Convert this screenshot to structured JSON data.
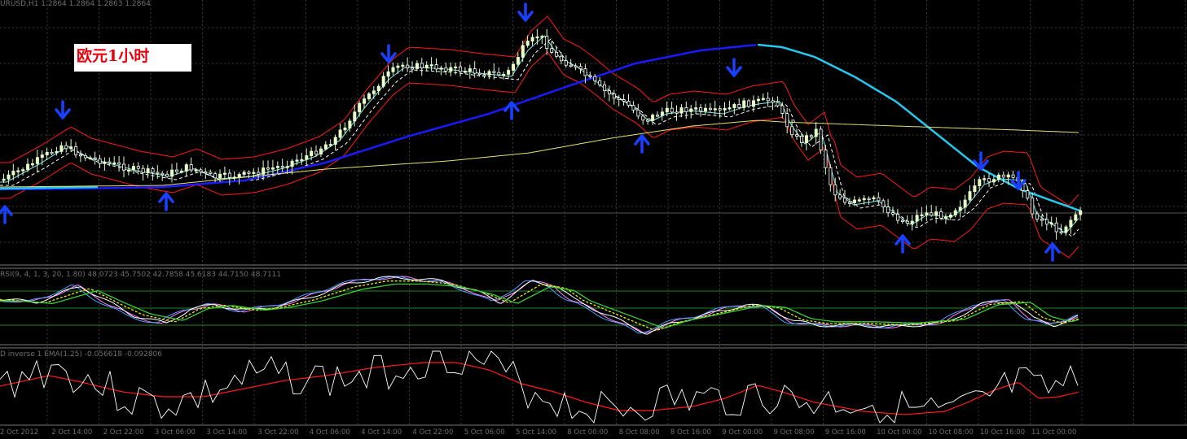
{
  "main_header": "URUSD,H1  1.2864 1.2864 1.2863 1.2864",
  "caption": "欧元1小时",
  "rsi_header": "RSI(9, 4, 1, 3, 20, 1.80) 48.0723 45.7502 42.7858 45.6183 44.7150 48.7111",
  "ind2_header": "D inverse 1  EMA(1.25) -0.056618 -0.092806",
  "time_axis": [
    "2 Oct 2012",
    "2 Oct 14:00",
    "2 Oct 22:00",
    "3 Oct 06:00",
    "3 Oct 14:00",
    "3 Oct 22:00",
    "4 Oct 06:00",
    "4 Oct 14:00",
    "4 Oct 22:00",
    "5 Oct 06:00",
    "5 Oct 14:00",
    "8 Oct 00:00",
    "8 Oct 08:00",
    "8 Oct 16:00",
    "9 Oct 00:00",
    "9 Oct 08:00",
    "9 Oct 16:00",
    "10 Oct 00:00",
    "10 Oct 08:00",
    "10 Oct 16:00",
    "11 Oct 00:00"
  ],
  "colors": {
    "background": "#000000",
    "grid": "#3a3a3a",
    "candle_bull": "#e8ffc8",
    "candle_bear": "#ffffff",
    "ma_slow": "#1a1aff",
    "ma_slow_tail": "#26c8ee",
    "ma_long": "#e8e070",
    "band": "#ff1a1a",
    "signal_arrow": "#1a40ff",
    "rsi_level": "#228822",
    "osc_white": "#ffffff",
    "osc_red": "#ff1a1a"
  },
  "icons": {
    "up": "blue-up-arrow-icon",
    "down": "blue-down-arrow-icon"
  }
}
